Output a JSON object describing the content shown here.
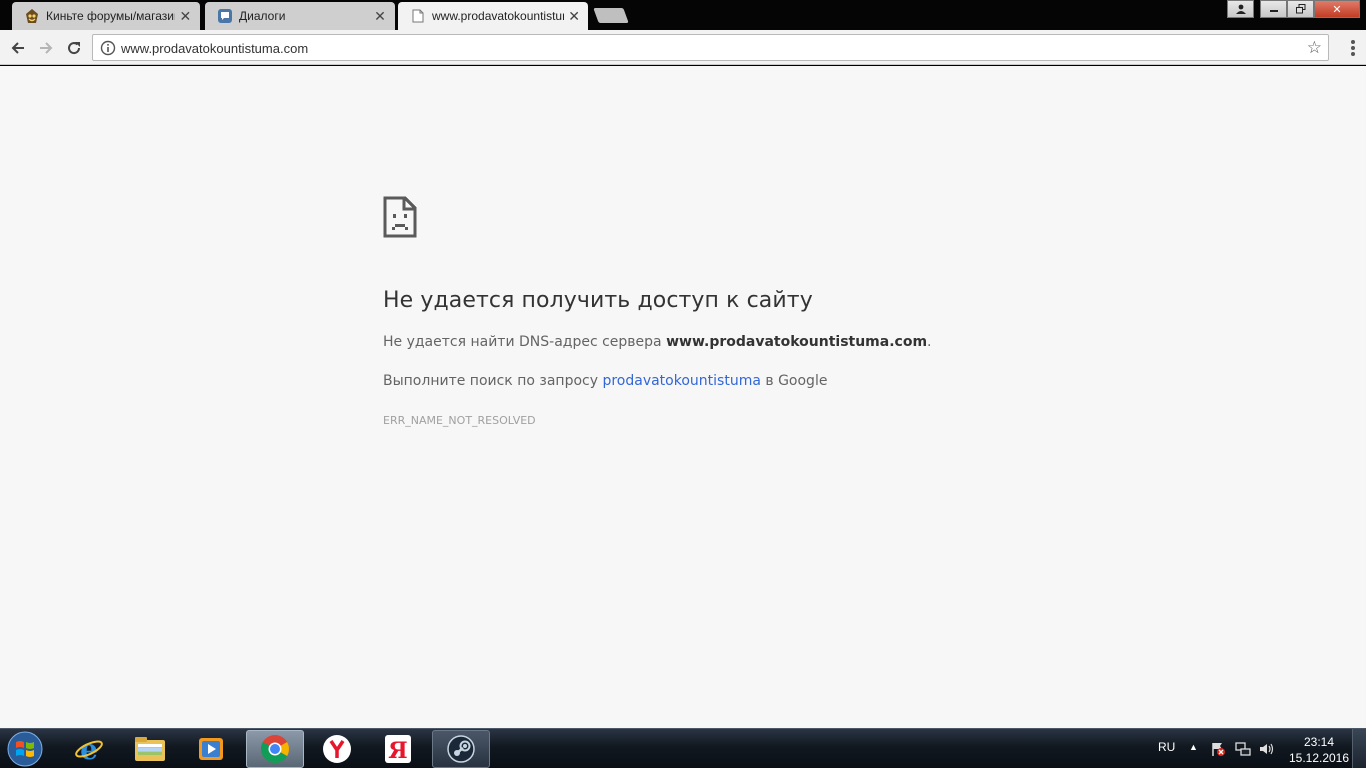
{
  "tabs": [
    {
      "title": "Киньте форумы/магазин",
      "icon": "forum-favicon",
      "state": "inactive"
    },
    {
      "title": "Диалоги",
      "icon": "vk-dialogs-favicon",
      "state": "inactive"
    },
    {
      "title": "www.prodavatokountistuma.com",
      "icon": "page-icon",
      "state": "active"
    }
  ],
  "omnibox": {
    "url": "www.prodavatokountistuma.com"
  },
  "error_page": {
    "title": "Не удается получить доступ к сайту",
    "dns_prefix": "Не удается найти DNS-адрес сервера ",
    "dns_host": "www.prodavatokountistuma.com",
    "dns_suffix": ".",
    "search_prefix": "Выполните поиск по запросу ",
    "search_query": "prodavatokountistuma",
    "search_suffix": " в Google",
    "error_code": "ERR_NAME_NOT_RESOLVED"
  },
  "taskbar": {
    "items": [
      "windows-start-icon",
      "internet-explorer-icon",
      "file-explorer-icon",
      "media-player-icon",
      "chrome-icon",
      "yandex-browser-icon",
      "yandex-icon",
      "steam-icon"
    ],
    "tray": {
      "language": "RU",
      "time": "23:14",
      "date": "15.12.2016"
    }
  },
  "colors": {
    "tab_strip": "#050505",
    "page_background": "#f7f7f7",
    "link": "#3367d6",
    "taskbar": "#111820"
  }
}
